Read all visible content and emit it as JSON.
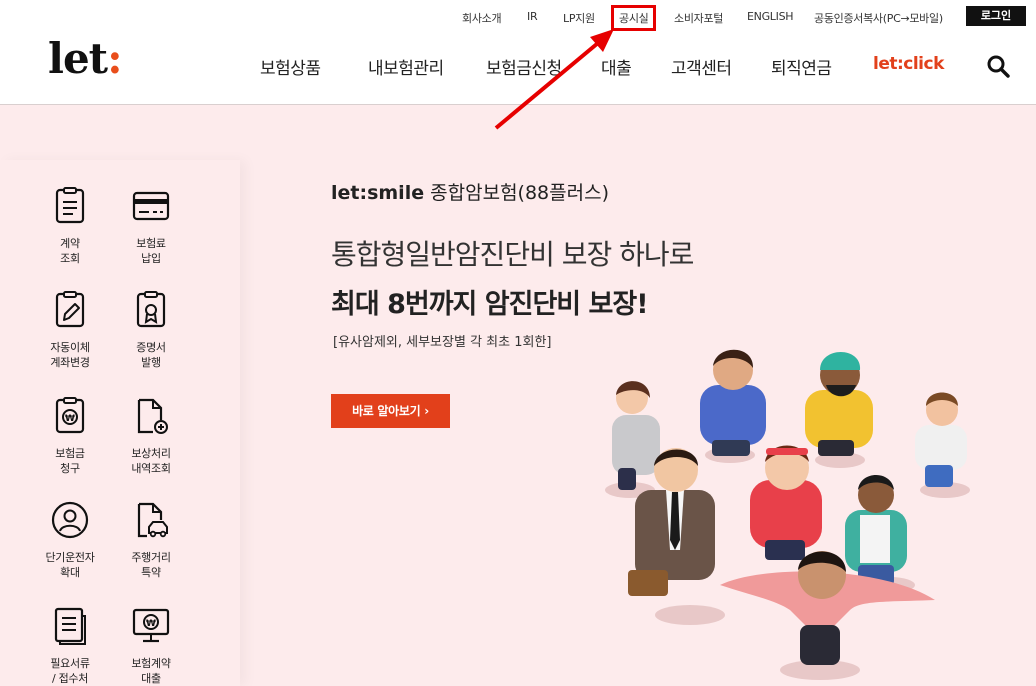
{
  "util_links": [
    "회사소개",
    "IR",
    "LP지원",
    "공시실",
    "소비자포털",
    "ENGLISH",
    "공동인증서복사(PC→모바일)"
  ],
  "login_label": "로그인",
  "logo": {
    "text": "let",
    "colon": ":"
  },
  "nav": [
    "보험상품",
    "내보험관리",
    "보험금신청",
    "대출",
    "고객센터",
    "퇴직연금",
    "let:click"
  ],
  "quick_menu": [
    {
      "label": "계약\n조회",
      "icon": "contract-icon"
    },
    {
      "label": "보험료\n납입",
      "icon": "card-icon"
    },
    {
      "label": "자동이체\n계좌변경",
      "icon": "edit-doc-icon"
    },
    {
      "label": "증명서\n발행",
      "icon": "certificate-icon"
    },
    {
      "label": "보험금\n청구",
      "icon": "won-doc-icon"
    },
    {
      "label": "보상처리\n내역조회",
      "icon": "doc-search-icon"
    },
    {
      "label": "단기운전자\n확대",
      "icon": "person-circle-icon"
    },
    {
      "label": "주행거리\n특약",
      "icon": "car-doc-icon"
    },
    {
      "label": "필요서류\n/ 접수처",
      "icon": "list-doc-icon"
    },
    {
      "label": "보험계약\n대출",
      "icon": "monitor-won-icon"
    }
  ],
  "banner": {
    "product_brand": "let:smile",
    "product_name": " 종합암보험(88플러스)",
    "headline1": "통합형일반암진단비 보장 하나로",
    "headline2": "최대 8번까지 암진단비 보장!",
    "note": "[유사암제외, 세부보장별 각 최초 1회한]",
    "cta": "바로 알아보기",
    "cta_arrow": "›"
  },
  "colors": {
    "accent": "#e2401b",
    "highlight": "#e60000",
    "background": "#fdebec"
  }
}
